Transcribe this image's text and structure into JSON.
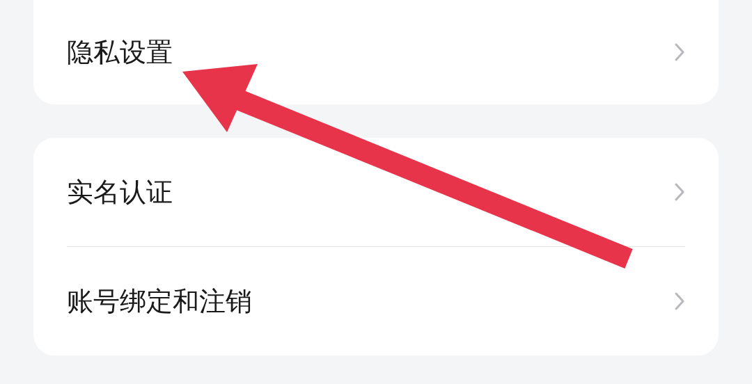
{
  "groups": [
    {
      "items": [
        {
          "label": "隐私设置"
        }
      ]
    },
    {
      "items": [
        {
          "label": "实名认证"
        },
        {
          "label": "账号绑定和注销"
        }
      ]
    }
  ]
}
